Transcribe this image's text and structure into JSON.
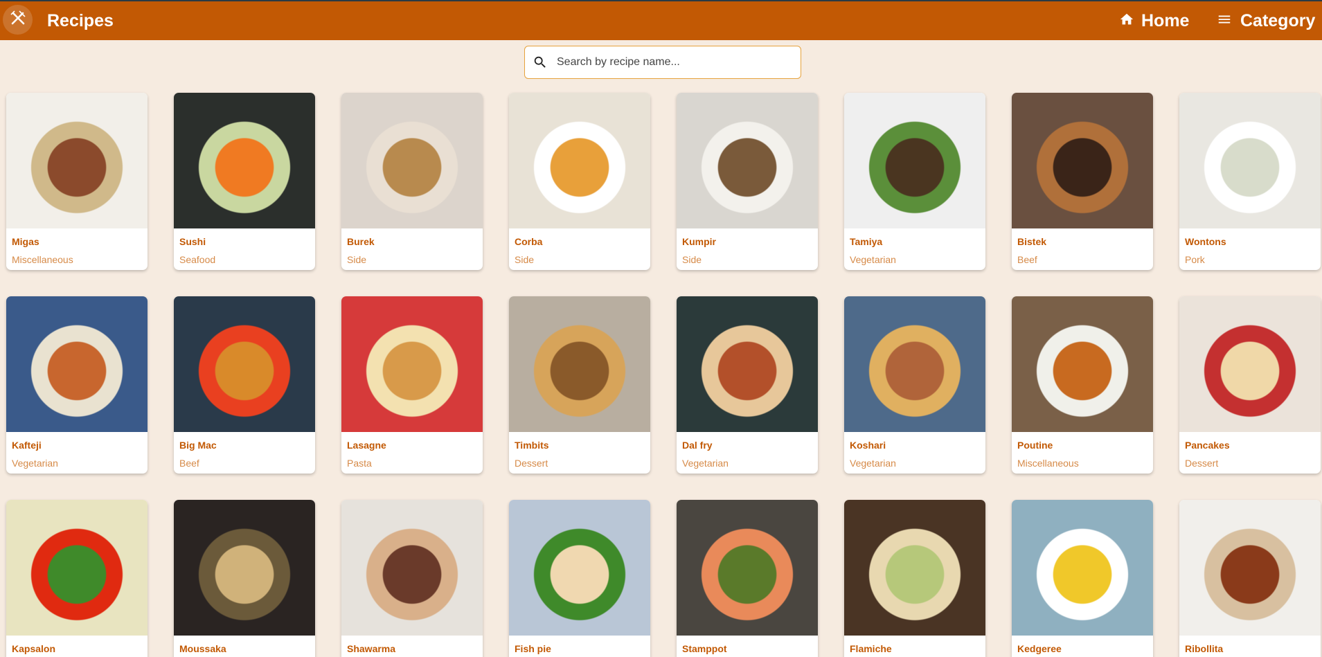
{
  "header": {
    "brand": "Recipes",
    "logo_icon": "fork-knife-icon",
    "nav": [
      {
        "label": "Home",
        "icon": "home-icon"
      },
      {
        "label": "Category",
        "icon": "menu-icon"
      }
    ],
    "color": "#c25904"
  },
  "search": {
    "placeholder": "Search by recipe name...",
    "value": "",
    "icon": "search-icon"
  },
  "recipes": [
    {
      "name": "Migas",
      "category": "Miscellaneous"
    },
    {
      "name": "Sushi",
      "category": "Seafood"
    },
    {
      "name": "Burek",
      "category": "Side"
    },
    {
      "name": "Corba",
      "category": "Side"
    },
    {
      "name": "Kumpir",
      "category": "Side"
    },
    {
      "name": "Tamiya",
      "category": "Vegetarian"
    },
    {
      "name": "Bistek",
      "category": "Beef"
    },
    {
      "name": "Wontons",
      "category": "Pork"
    },
    {
      "name": "Kafteji",
      "category": "Vegetarian"
    },
    {
      "name": "Big Mac",
      "category": "Beef"
    },
    {
      "name": "Lasagne",
      "category": "Pasta"
    },
    {
      "name": "Timbits",
      "category": "Dessert"
    },
    {
      "name": "Dal fry",
      "category": "Vegetarian"
    },
    {
      "name": "Koshari",
      "category": "Vegetarian"
    },
    {
      "name": "Poutine",
      "category": "Miscellaneous"
    },
    {
      "name": "Pancakes",
      "category": "Dessert"
    },
    {
      "name": "Kapsalon",
      "category": ""
    },
    {
      "name": "Moussaka",
      "category": ""
    },
    {
      "name": "Shawarma",
      "category": ""
    },
    {
      "name": "Fish pie",
      "category": ""
    },
    {
      "name": "Stamppot",
      "category": ""
    },
    {
      "name": "Flamiche",
      "category": ""
    },
    {
      "name": "Kedgeree",
      "category": ""
    },
    {
      "name": "Ribollita",
      "category": ""
    }
  ]
}
